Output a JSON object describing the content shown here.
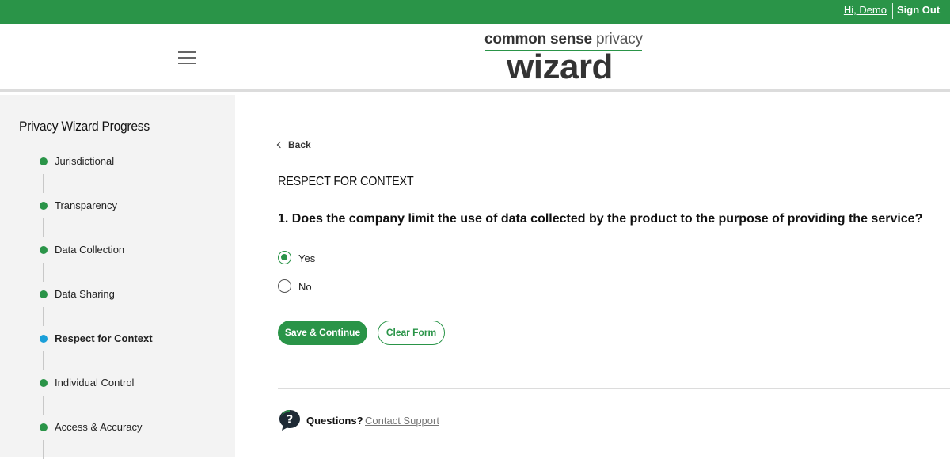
{
  "topbar": {
    "greeting": "Hi, Demo",
    "signout": "Sign Out",
    "color": "#2a9448"
  },
  "logo": {
    "line1_bold": "common sense",
    "line1_light": " privacy",
    "main": "wizard"
  },
  "header": {
    "menu_icon": "hamburger-menu-icon"
  },
  "sidebar": {
    "title": "Privacy Wizard Progress",
    "steps": [
      {
        "label": "Jurisdictional",
        "status": "complete"
      },
      {
        "label": "Transparency",
        "status": "complete"
      },
      {
        "label": "Data Collection",
        "status": "complete"
      },
      {
        "label": "Data Sharing",
        "status": "complete"
      },
      {
        "label": "Respect for Context",
        "status": "current"
      },
      {
        "label": "Individual Control",
        "status": "complete"
      },
      {
        "label": "Access & Accuracy",
        "status": "complete"
      }
    ],
    "complete_color": "#2a9448",
    "current_color": "#1a9fd9"
  },
  "main": {
    "back_label": "Back",
    "section_title": "RESPECT FOR CONTEXT",
    "question": "1. Does the company limit the use of data collected by the product to the purpose of providing the service?",
    "options": [
      {
        "label": "Yes",
        "selected": true
      },
      {
        "label": "No",
        "selected": false
      }
    ],
    "save_label": "Save & Continue",
    "clear_label": "Clear Form",
    "questions_label": "Questions?",
    "contact_label": "Contact Support"
  }
}
